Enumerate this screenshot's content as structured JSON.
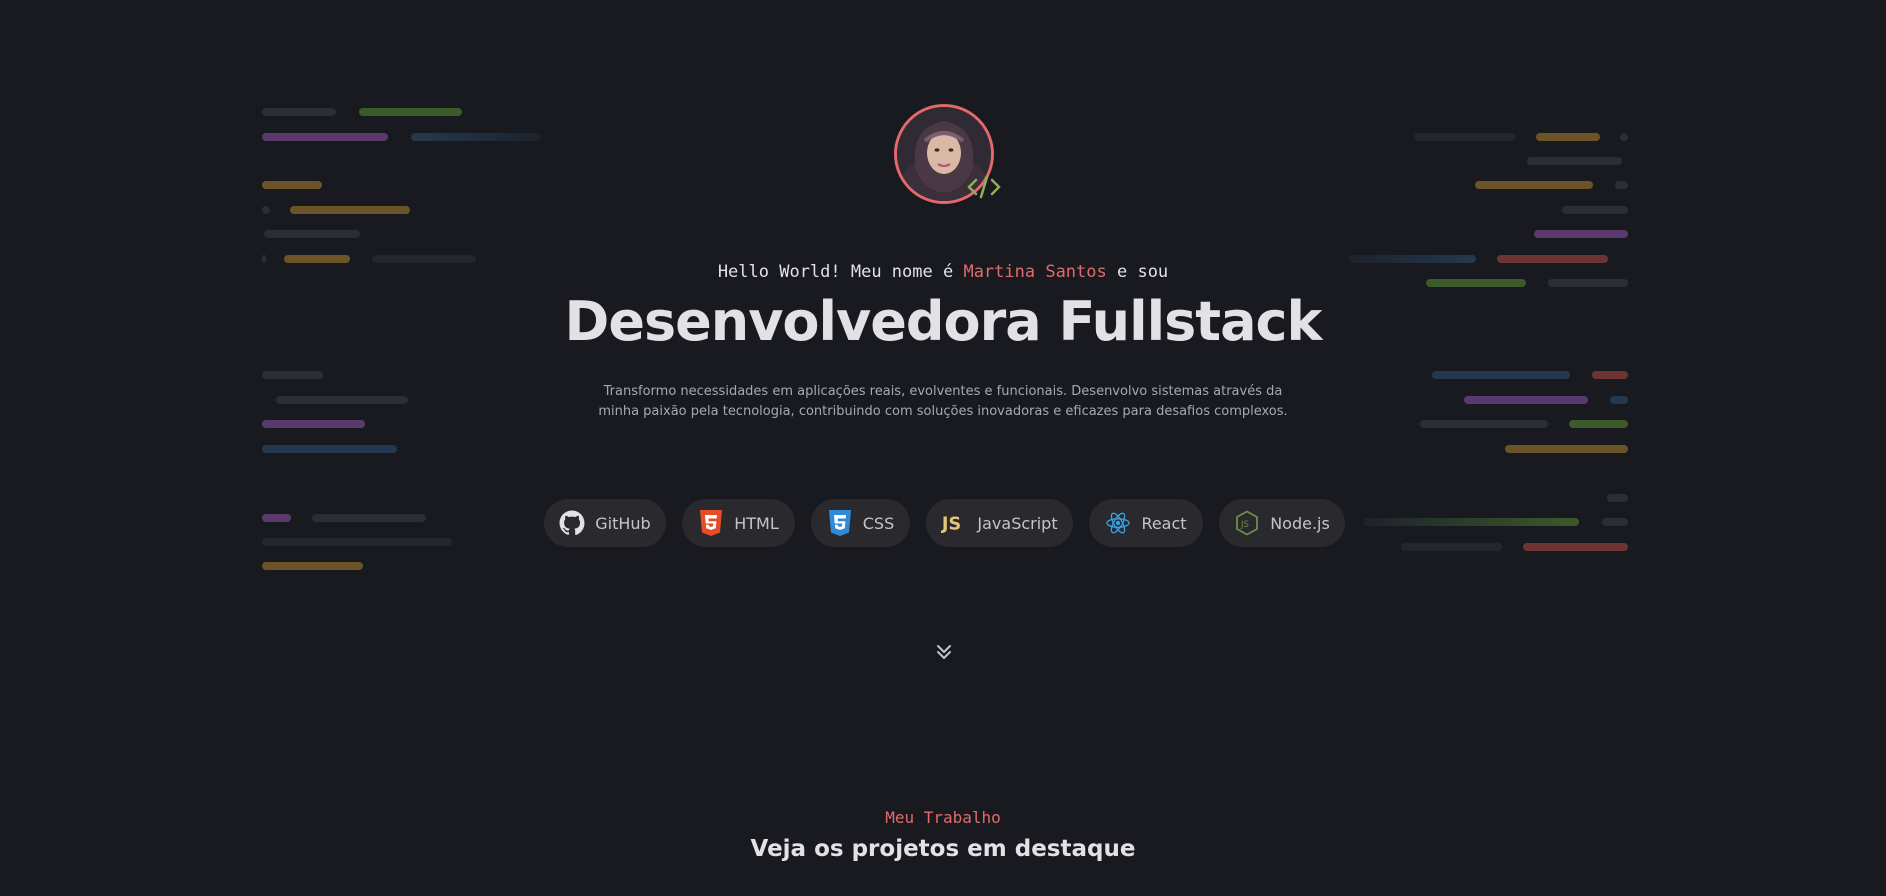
{
  "hero": {
    "intro_prefix": "Hello World! Meu nome é ",
    "name": "Martina Santos",
    "intro_suffix": " e sou",
    "headline": "Desenvolvedora Fullstack",
    "description_line1": "Transformo necessidades em aplicações reais, evolventes e funcionais. Desenvolvo sistemas através da",
    "description_line2": "minha paixão pela tecnologia, contribuindo com soluções inovadoras e eficazes para desafios complexos.",
    "avatar_icon": "avatar",
    "badge_icon": "code-brackets-icon"
  },
  "techs": [
    {
      "label": "GitHub",
      "icon": "github-icon"
    },
    {
      "label": "HTML",
      "icon": "html5-icon"
    },
    {
      "label": "CSS",
      "icon": "css3-icon"
    },
    {
      "label": "JavaScript",
      "icon": "javascript-icon"
    },
    {
      "label": "React",
      "icon": "react-icon"
    },
    {
      "label": "Node.js",
      "icon": "nodejs-icon"
    }
  ],
  "scroll_hint_icon": "chevrons-down-icon",
  "section": {
    "kicker": "Meu Trabalho",
    "title": "Veja os projetos em destaque"
  },
  "colors": {
    "background": "#191a20",
    "accent": "#e36a6a",
    "pill_bg": "#29292e",
    "text": "#e1e1e6",
    "muted": "#a8a8b3"
  }
}
